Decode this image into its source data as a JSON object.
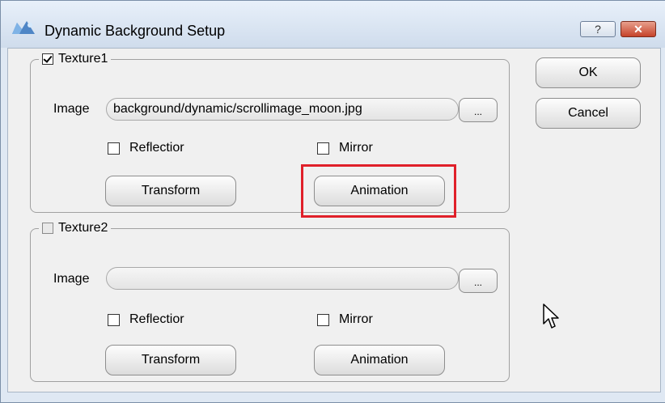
{
  "window": {
    "title": "Dynamic Background Setup",
    "help_label": "?",
    "close_label": "✕"
  },
  "texture1": {
    "label": "Texture1",
    "checked": true,
    "image_label": "Image",
    "image_value": "background/dynamic/scrollimage_moon.jpg",
    "browse_label": "...",
    "reflection_label": "Reflectior",
    "mirror_label": "Mirror",
    "transform_label": "Transform",
    "animation_label": "Animation"
  },
  "texture2": {
    "label": "Texture2",
    "checked": false,
    "image_label": "Image",
    "image_value": "",
    "browse_label": "...",
    "reflection_label": "Reflectior",
    "mirror_label": "Mirror",
    "transform_label": "Transform",
    "animation_label": "Animation"
  },
  "actions": {
    "ok_label": "OK",
    "cancel_label": "Cancel"
  },
  "colors": {
    "highlight": "#e0202a"
  }
}
